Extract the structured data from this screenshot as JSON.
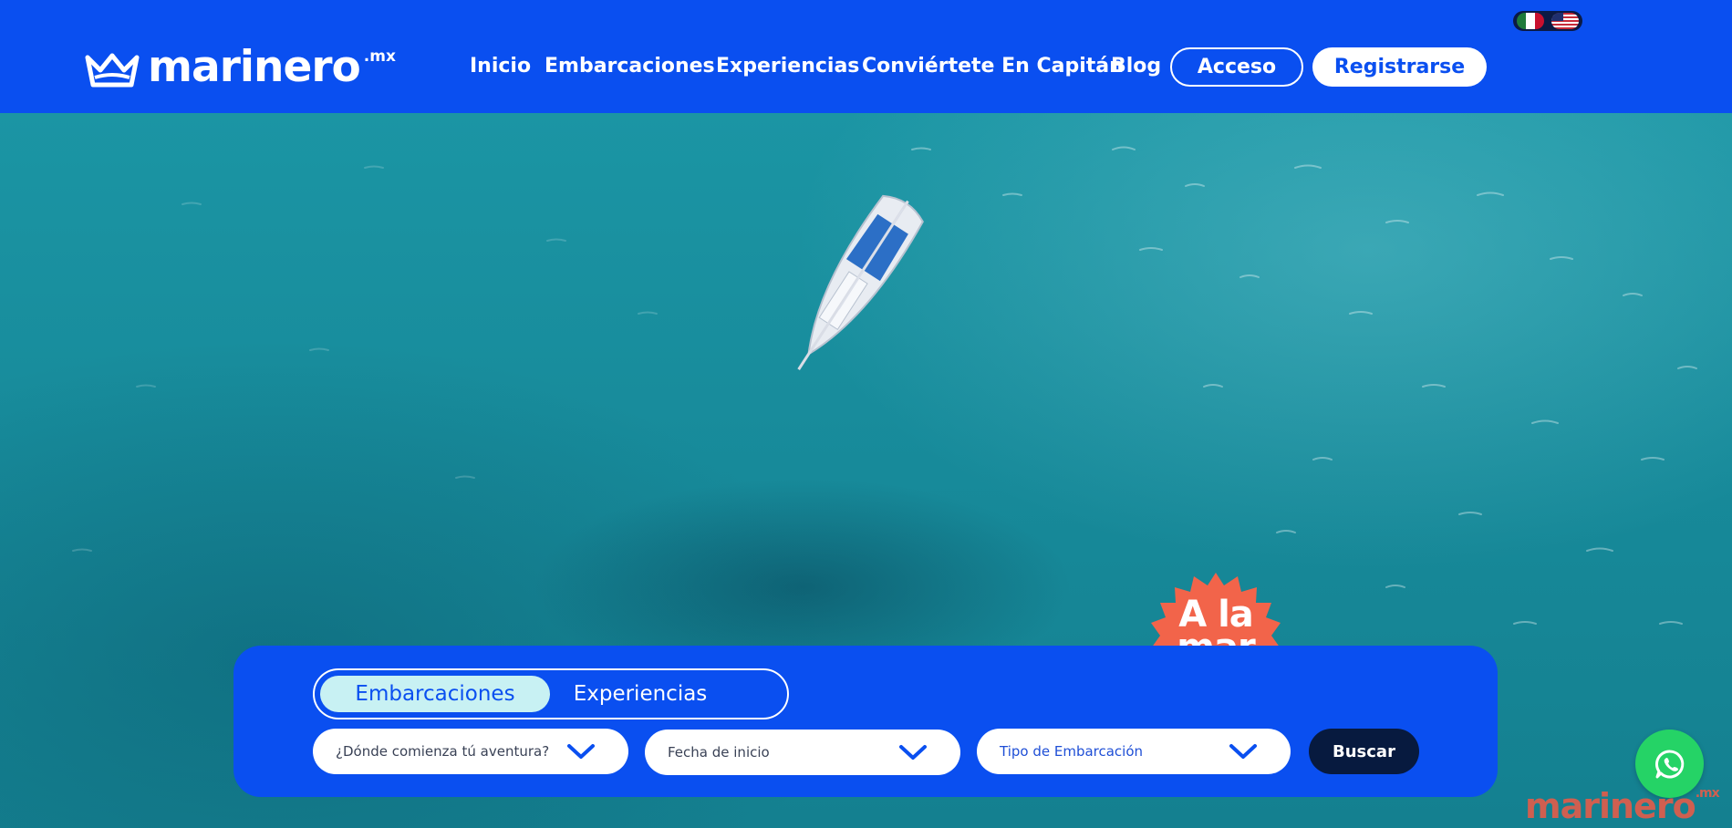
{
  "header": {
    "logo_text": "marinero",
    "logo_tld": ".mx",
    "languages": [
      "mexico-flag",
      "usa-flag"
    ],
    "nav": [
      "Inicio",
      "Embarcaciones",
      "Experiencias",
      "Conviértete En Capitán",
      "Blog"
    ],
    "login_label": "Acceso",
    "register_label": "Registrarse",
    "brand_color": "#0a4ff0"
  },
  "badge": {
    "line1": "A la",
    "line2": "mar",
    "color": "#f2644a"
  },
  "search": {
    "tabs": [
      "Embarcaciones",
      "Experiencias"
    ],
    "active_tab": "Embarcaciones",
    "location_placeholder": "¿Dónde comienza tú aventura?",
    "date_placeholder": "Fecha de inicio",
    "type_placeholder": "Tipo de Embarcación",
    "submit_label": "Buscar"
  },
  "watermark": {
    "text": "marinero",
    "tld": ".mx"
  },
  "whatsapp": {
    "icon": "whatsapp-icon",
    "color": "#25d366"
  }
}
